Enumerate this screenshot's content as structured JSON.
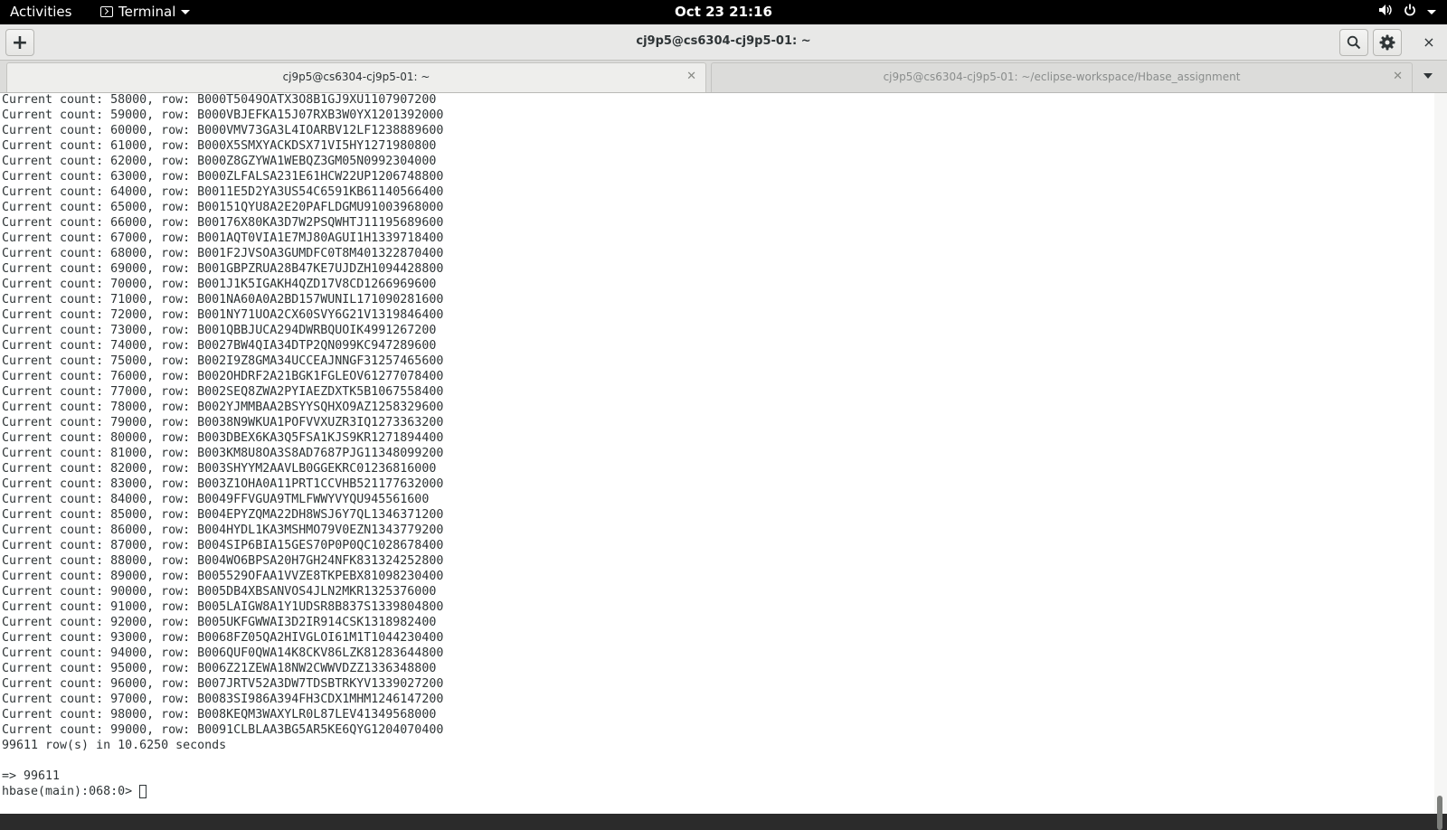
{
  "topbar": {
    "activities": "Activities",
    "app_name": "Terminal",
    "clock": "Oct 23  21:16",
    "icons": [
      "volume-icon",
      "power-icon",
      "chevron-down-icon"
    ]
  },
  "window": {
    "title": "cj9p5@cs6304-cj9p5-01: ~",
    "new_tab_label": "+",
    "close_label": "×"
  },
  "tabs": [
    {
      "label": "cj9p5@cs6304-cj9p5-01: ~",
      "active": true
    },
    {
      "label": "cj9p5@cs6304-cj9p5-01: ~/eclipse-workspace/Hbase_assignment",
      "active": false
    }
  ],
  "terminal": {
    "lines": [
      "Current count: 58000, row: B000T5049OATX3O8B1GJ9XU1107907200",
      "Current count: 59000, row: B000VBJEFKA15J07RXB3W0YX1201392000",
      "Current count: 60000, row: B000VMV73GA3L4IOARBV12LF1238889600",
      "Current count: 61000, row: B000X5SMXYACKDSX71VI5HY1271980800",
      "Current count: 62000, row: B000Z8GZYWA1WEBQZ3GM05N0992304000",
      "Current count: 63000, row: B000ZLFALSA231E61HCW22UP1206748800",
      "Current count: 64000, row: B0011E5D2YA3US54C6591KB61140566400",
      "Current count: 65000, row: B00151QYU8A2E20PAFLDGMU91003968000",
      "Current count: 66000, row: B00176X80KA3D7W2PSQWHTJ11195689600",
      "Current count: 67000, row: B001AQT0VIA1E7MJ80AGUI1H1339718400",
      "Current count: 68000, row: B001F2JVSOA3GUMDFC0T8M401322870400",
      "Current count: 69000, row: B001GBPZRUA28B47KE7UJDZH1094428800",
      "Current count: 70000, row: B001J1K5IGAKH4QZD17V8CD1266969600",
      "Current count: 71000, row: B001NA60A0A2BD157WUNIL171090281600",
      "Current count: 72000, row: B001NY71UOA2CX60SVY6G21V1319846400",
      "Current count: 73000, row: B001QBBJUCA294DWRBQUOIK4991267200",
      "Current count: 74000, row: B0027BW4QIA34DTP2QN099KC947289600",
      "Current count: 75000, row: B002I9Z8GMA34UCCEAJNNGF31257465600",
      "Current count: 76000, row: B002OHDRF2A21BGK1FGLEOV61277078400",
      "Current count: 77000, row: B002SEQ8ZWA2PYIAEZDXTK5B1067558400",
      "Current count: 78000, row: B002YJMMBAA2BSYYSQHXO9AZ1258329600",
      "Current count: 79000, row: B0038N9WKUA1POFVVXUZR3IQ1273363200",
      "Current count: 80000, row: B003DBEX6KA3Q5FSA1KJS9KR1271894400",
      "Current count: 81000, row: B003KM8U8OA3S8AD7687PJG11348099200",
      "Current count: 82000, row: B003SHYYM2AAVLB0GGEKRC01236816000",
      "Current count: 83000, row: B003Z1OHA0A11PRT1CCVHB521177632000",
      "Current count: 84000, row: B0049FFVGUA9TMLFWWYVYQU945561600",
      "Current count: 85000, row: B004EPYZQMA22DH8WSJ6Y7QL1346371200",
      "Current count: 86000, row: B004HYDL1KA3MSHMO79V0EZN1343779200",
      "Current count: 87000, row: B004SIP6BIA15GES70P0P0QC1028678400",
      "Current count: 88000, row: B004WO6BPSA20H7GH24NFK831324252800",
      "Current count: 89000, row: B005529OFAA1VVZE8TKPEBX81098230400",
      "Current count: 90000, row: B005DB4XBSANVOS4JLN2MKR1325376000",
      "Current count: 91000, row: B005LAIGW8A1Y1UDSR8B837S1339804800",
      "Current count: 92000, row: B005UKFGWWAI3D2IR914CSK1318982400",
      "Current count: 93000, row: B0068FZ05QA2HIVGLOI61M1T1044230400",
      "Current count: 94000, row: B006QUF0QWA14K8CKV86LZK81283644800",
      "Current count: 95000, row: B006Z21ZEWA18NW2CWWVDZZ1336348800",
      "Current count: 96000, row: B007JRTV52A3DW7TDSBTRKYV1339027200",
      "Current count: 97000, row: B0083SI986A394FH3CDX1MHM1246147200",
      "Current count: 98000, row: B008KEQM3WAXYLR0L87LEV41349568000",
      "Current count: 99000, row: B0091CLBLAA3BG5AR5KE6QYG1204070400",
      "99611 row(s) in 10.6250 seconds",
      "",
      "=> 99611"
    ],
    "prompt": "hbase(main):068:0>"
  }
}
